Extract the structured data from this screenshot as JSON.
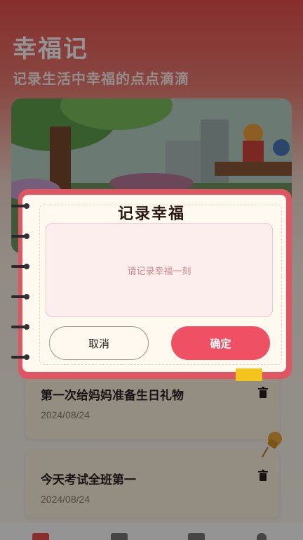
{
  "app": {
    "title": "幸福记",
    "subtitle": "记录生活中幸福的点点滴滴"
  },
  "entries": [
    {
      "text": "第一次给妈妈准备生日礼物",
      "date": "2024/08/24"
    },
    {
      "text": "今天考试全班第一",
      "date": "2024/08/24"
    }
  ],
  "dialog": {
    "title": "记录幸福",
    "placeholder": "请记录幸福一刻",
    "cancel_label": "取消",
    "confirm_label": "确定"
  },
  "colors": {
    "accent": "#f05063",
    "dialog_frame": "#e05561",
    "paper": "#fff9ef",
    "bookmark": "#f3c41c"
  },
  "icons": [
    "trash-icon",
    "pushpin-icon",
    "notebook-ring-icon"
  ]
}
